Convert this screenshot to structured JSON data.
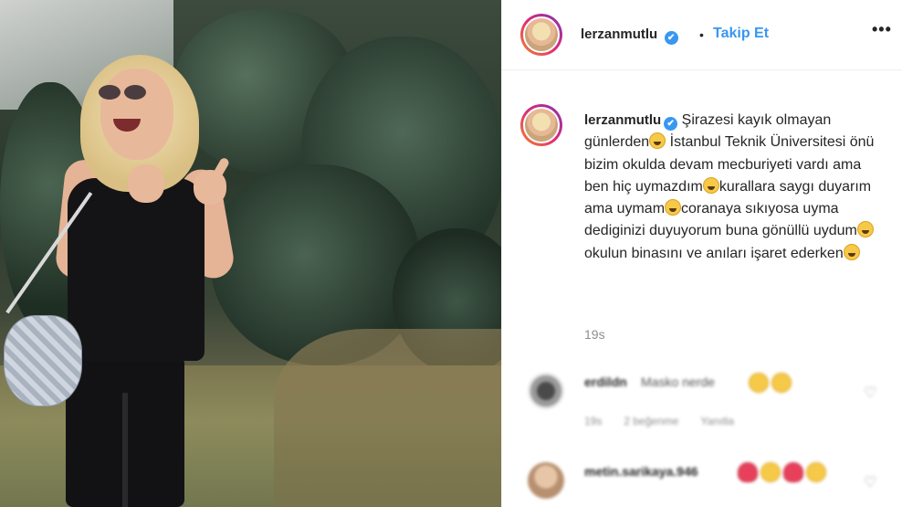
{
  "post": {
    "username": "lerzanmutlu",
    "verified_glyph": "✔",
    "dot": "•",
    "follow_label": "Takip Et",
    "more_label": "•••",
    "caption_parts": [
      "Şirazesi kayık olmayan günlerden",
      " İstanbul Teknik Üniversitesi önü bizim okulda devam mecburiyeti vardı ama ben hiç uymazdım",
      "kurallara saygı duyarım ama uymam",
      "coranaya sıkıyosa uyma dediginizi duyuyorum buna gönüllü uydum",
      " okulun binasını ve anıları işaret ederken"
    ],
    "time": "19s"
  },
  "comments": [
    {
      "username": "erdildn",
      "text": "Masko nerde",
      "emojis": [
        "laughing-emoji",
        "laughing-emoji"
      ],
      "meta": [
        "19s",
        "2 beğenme",
        "Yanıtla"
      ],
      "heart_glyph": "♡"
    },
    {
      "username": "metin.sarikaya.946",
      "emojis": [
        "heart-emoji",
        "laughing-emoji",
        "heart-emoji",
        "laughing-emoji"
      ],
      "meta": [],
      "heart_glyph": "♡"
    }
  ],
  "colors": {
    "accent": "#3897f0",
    "text": "#262626",
    "muted": "#8e8e8e",
    "divider": "#efefef"
  }
}
